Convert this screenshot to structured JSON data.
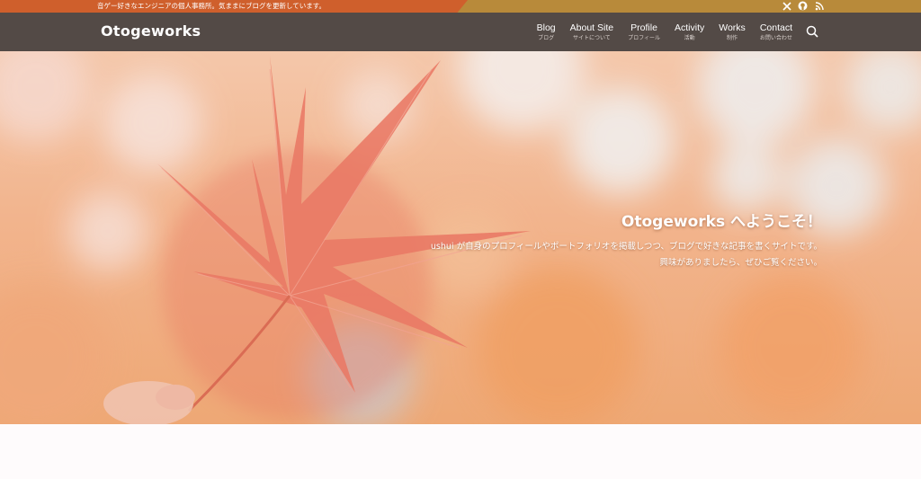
{
  "topbar": {
    "tagline": "音ゲー好きなエンジニアの個人事務所。気ままにブログを更新しています。",
    "icons": [
      "x-icon",
      "github-icon",
      "rss-icon"
    ]
  },
  "header": {
    "logo": "Otogeworks",
    "nav": [
      {
        "label": "Blog",
        "sub": "ブログ"
      },
      {
        "label": "About Site",
        "sub": "サイトについて"
      },
      {
        "label": "Profile",
        "sub": "プロフィール"
      },
      {
        "label": "Activity",
        "sub": "活動"
      },
      {
        "label": "Works",
        "sub": "制作"
      },
      {
        "label": "Contact",
        "sub": "お問い合わせ"
      }
    ],
    "search_icon": "search-icon"
  },
  "hero": {
    "title": "Otogeworks へようこそ！",
    "desc_line1": "ushui が自身のプロフィールやポートフォリオを掲載しつつ、ブログで好きな記事を書くサイトです。",
    "desc_line2": "興味がありましたら、ぜひご覧ください。"
  },
  "colors": {
    "topbar_left": "#cf5f2c",
    "topbar_right": "#b88a3a",
    "header_bg": "#534a46",
    "hero_leaf": "#e9725f"
  }
}
